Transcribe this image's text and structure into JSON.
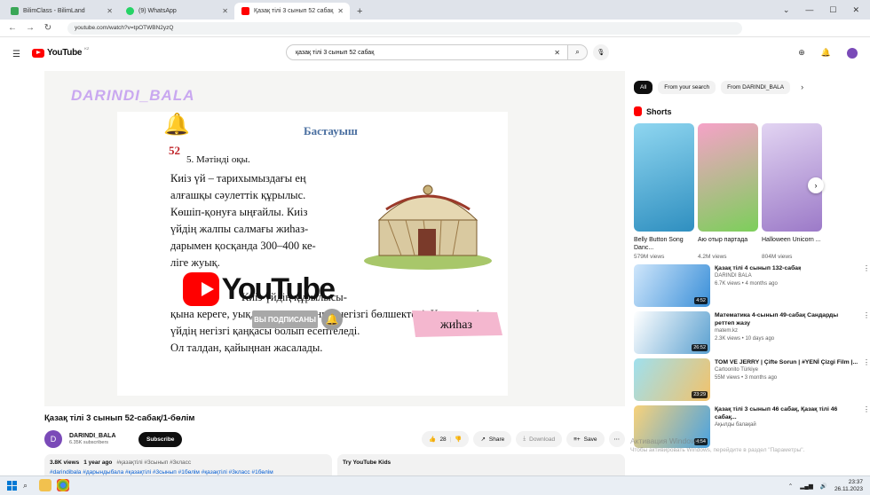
{
  "browser": {
    "tabs": [
      {
        "title": "BilimClass - BilimLand",
        "color": "#3aa757"
      },
      {
        "title": "(9) WhatsApp",
        "color": "#25d366"
      },
      {
        "title": "Қазақ тілі 3 сынып 52 сабақ",
        "color": "#ff0000"
      }
    ],
    "url": "youtube.com/watch?v=tpOTWBN2yzQ"
  },
  "header": {
    "logo_text": "YouTube",
    "region": "KZ",
    "search_value": "қазақ тілі 3 сынып 52 сабақ"
  },
  "video_frame": {
    "watermark": "DARINDI_BALA",
    "page_number": "52",
    "heading": "Бастауыш",
    "exercise": "5. Мәтінді оқы.",
    "paragraph_lines": [
      "Киіз үй – тарихымыздағы ең",
      "алғашқы сәулеттік құрылыс.",
      "Көшіп-қонуға ыңғайлы. Киіз",
      "үйдің жалпы салмағы жиһаз-",
      "дарымен қосқанда 300–400 ке-",
      "ліге жуық."
    ],
    "paragraph_cont_lines": [
      "Киіз үйдің құрылысы-",
      "қына кереге, уық, шаңырақ – оның негізгі бөлшектері. Кереге киіз",
      "үйдің негізгі қаңқасы болып есептеледі.",
      "Ол талдан, қайыңнан жасалады."
    ],
    "word_badge": "жиһаз",
    "overlay_logo": "YouTube",
    "subscribed_label": "ВЫ ПОДПИСАНЫ"
  },
  "video": {
    "title": "Қазақ тілі 3 сынып 52-сабақ/1-бөлім",
    "channel_initial": "D",
    "channel_name": "DARINDI_BALA",
    "subscribers": "6.35K subscribers",
    "subscribe_label": "Subscribe",
    "likes": "28",
    "share_label": "Share",
    "download_label": "Download",
    "save_label": "Save",
    "views": "3.8K views",
    "age": "1 year ago",
    "tags": "#қазақтілі #3сынып #3класс",
    "hashtag_line": "#darindibala #дарындыбала #қазақтілі #3сынып #1бөлім #қазақтілі #3класс #1бөлім",
    "promo_title": "Try YouTube Kids"
  },
  "sidebar": {
    "chips": [
      "All",
      "From your search",
      "From DARINDI_BALA"
    ],
    "shorts_label": "Shorts",
    "shorts": [
      {
        "title": "Belly Button Song Danc...",
        "views": "579M views",
        "color": "#4fb3d9"
      },
      {
        "title": "Аю отыр партада",
        "views": "4.2M views",
        "color": "#e86aa8"
      },
      {
        "title": "Halloween Unicorn ...",
        "views": "804M views",
        "color": "#b89bd8"
      }
    ],
    "videos": [
      {
        "title": "Қазақ тілі 4 сынып 132-сабақ",
        "channel": "DARINDI BALA",
        "meta": "6.7K views • 4 months ago",
        "duration": "4:52",
        "color": "#3a8fd8"
      },
      {
        "title": "Математика 4-сынып 49-сабақ Сандарды реттеп жазу",
        "channel": "matem.kz",
        "meta": "2.3K views • 10 days ago",
        "duration": "26:52",
        "color": "#5aa0d0"
      },
      {
        "title": "TOM VE JERRY | Çifte Sorun | #YENİ Çizgi Film |...",
        "channel": "Cartoonito Türkiye",
        "meta": "55M views • 3 months ago",
        "duration": "23:29",
        "color": "#6bbfd4"
      },
      {
        "title": "Қазақ тілі 3 сынып 46 сабақ, Қазақ тілі 46 сабақ...",
        "channel": "Ақылды балақай",
        "meta": "",
        "duration": "4:54",
        "color": "#f0b040"
      }
    ]
  },
  "windows": {
    "activation_title": "Активация Windows",
    "activation_text": "Чтобы активировать Windows, перейдите в раздел \"Параметры\".",
    "time": "23:37",
    "date": "26.11.2023"
  }
}
